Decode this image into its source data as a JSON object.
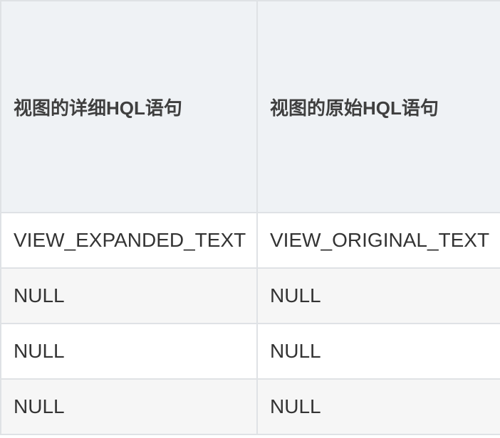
{
  "table": {
    "headers": [
      "视图的详细HQL语句",
      "视图的原始HQL语句"
    ],
    "rows": [
      [
        "VIEW_EXPANDED_TEXT",
        "VIEW_ORIGINAL_TEXT"
      ],
      [
        "NULL",
        "NULL"
      ],
      [
        "NULL",
        "NULL"
      ],
      [
        "NULL",
        "NULL"
      ]
    ]
  }
}
